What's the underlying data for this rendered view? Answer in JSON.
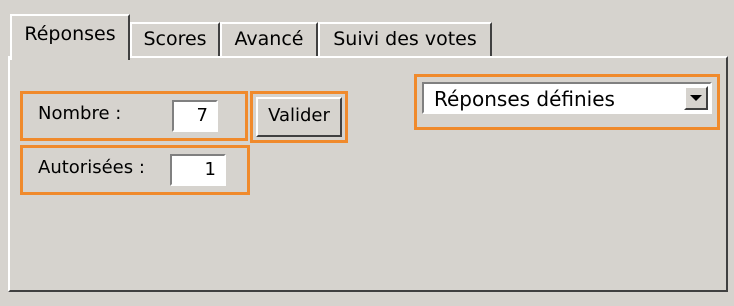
{
  "tabs": [
    {
      "label": "Réponses",
      "active": true
    },
    {
      "label": "Scores",
      "active": false
    },
    {
      "label": "Avancé",
      "active": false
    },
    {
      "label": "Suivi des votes",
      "active": false
    }
  ],
  "form": {
    "nombre_label": "Nombre :",
    "nombre_value": "7",
    "valider_label": "Valider",
    "autorisees_label": "Autorisées :",
    "autorisees_value": "1",
    "mode_select_value": "Réponses définies"
  },
  "colors": {
    "background": "#d6d3ce",
    "highlight": "#f08a2c"
  },
  "icons": {
    "dropdown": "chevron-down-icon"
  }
}
